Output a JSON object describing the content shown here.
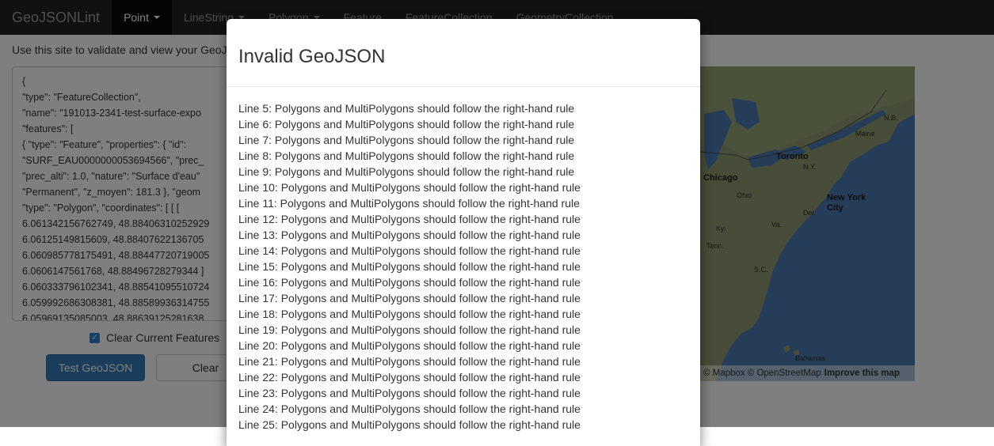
{
  "navbar": {
    "brand": "GeoJSONLint",
    "items": [
      {
        "label": "Point",
        "dropdown": true,
        "active": true
      },
      {
        "label": "LineString",
        "dropdown": true,
        "active": false
      },
      {
        "label": "Polygon",
        "dropdown": true,
        "active": false
      },
      {
        "label": "Feature",
        "dropdown": false,
        "active": false
      },
      {
        "label": "FeatureCollection",
        "dropdown": false,
        "active": false
      },
      {
        "label": "GeometryCollection",
        "dropdown": false,
        "active": false
      }
    ]
  },
  "intro": "Use this site to validate and view your GeoJ",
  "editor": {
    "lines": [
      "{",
      "\"type\": \"FeatureCollection\",",
      "\"name\": \"191013-2341-test-surface-expo",
      "\"features\": [",
      "{ \"type\": \"Feature\", \"properties\": { \"id\":",
      "\"SURF_EAU0000000053694566\", \"prec_",
      "\"prec_alti\": 1.0, \"nature\": \"Surface d'eau\"",
      "\"Permanent\", \"z_moyen\": 181.3 }, \"geom",
      "\"type\": \"Polygon\", \"coordinates\": [ [ [",
      "6.061342156762749, 48.88406310252929",
      "6.06125149815609, 48.88407622136705",
      "6.060985778175491, 48.88447720719005",
      "6.0606147561768, 48.88496728279344 ]",
      "6.060333796102341, 48.88541095510724",
      "6.059992686308381, 48.88589936314755",
      "6.05969135085003, 48.88639125281638"
    ]
  },
  "clear_checkbox": {
    "label": "Clear Current Features",
    "checked": true
  },
  "buttons": {
    "test": "Test GeoJSON",
    "clear": "Clear"
  },
  "map": {
    "labels": {
      "toronto": "Toronto",
      "chicago": "Chicago",
      "new_york": "New York",
      "city": "City",
      "bahamas": "Bahamas"
    },
    "small_labels": {
      "nb": "N.B.",
      "maine": "Maine",
      "ny": "N.Y.",
      "ohio": "Ohio",
      "ky": "Ky.",
      "tenn": "Tenn.",
      "sc": "S.C.",
      "del": "Del.",
      "va": "Va."
    },
    "attribution": "© Mapbox © OpenStreetMap",
    "improve": "Improve this map",
    "water_color": "#4b7bb3",
    "land_color": "#8a9a6b"
  },
  "modal": {
    "title": "Invalid GeoJSON",
    "errors": [
      "Line 5: Polygons and MultiPolygons should follow the right-hand rule",
      "Line 6: Polygons and MultiPolygons should follow the right-hand rule",
      "Line 7: Polygons and MultiPolygons should follow the right-hand rule",
      "Line 8: Polygons and MultiPolygons should follow the right-hand rule",
      "Line 9: Polygons and MultiPolygons should follow the right-hand rule",
      "Line 10: Polygons and MultiPolygons should follow the right-hand rule",
      "Line 11: Polygons and MultiPolygons should follow the right-hand rule",
      "Line 12: Polygons and MultiPolygons should follow the right-hand rule",
      "Line 13: Polygons and MultiPolygons should follow the right-hand rule",
      "Line 14: Polygons and MultiPolygons should follow the right-hand rule",
      "Line 15: Polygons and MultiPolygons should follow the right-hand rule",
      "Line 16: Polygons and MultiPolygons should follow the right-hand rule",
      "Line 17: Polygons and MultiPolygons should follow the right-hand rule",
      "Line 18: Polygons and MultiPolygons should follow the right-hand rule",
      "Line 19: Polygons and MultiPolygons should follow the right-hand rule",
      "Line 20: Polygons and MultiPolygons should follow the right-hand rule",
      "Line 21: Polygons and MultiPolygons should follow the right-hand rule",
      "Line 22: Polygons and MultiPolygons should follow the right-hand rule",
      "Line 23: Polygons and MultiPolygons should follow the right-hand rule",
      "Line 24: Polygons and MultiPolygons should follow the right-hand rule",
      "Line 25: Polygons and MultiPolygons should follow the right-hand rule"
    ]
  }
}
